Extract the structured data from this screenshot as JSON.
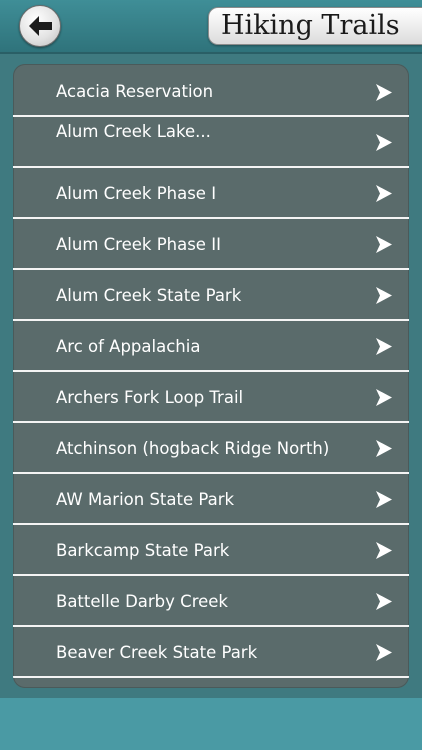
{
  "header": {
    "title": "Hiking Trails",
    "back_icon": "back-arrow-icon"
  },
  "trails": [
    {
      "label": "Acacia Reservation",
      "icon": "chevron-right-icon"
    },
    {
      "label": "Alum Creek Lake...",
      "icon": "chevron-right-icon"
    },
    {
      "label": "Alum Creek Phase I",
      "icon": "chevron-right-icon"
    },
    {
      "label": "Alum Creek Phase II",
      "icon": "chevron-right-icon"
    },
    {
      "label": "Alum Creek State Park",
      "icon": "chevron-right-icon"
    },
    {
      "label": "Arc of Appalachia",
      "icon": "chevron-right-icon"
    },
    {
      "label": "Archers Fork Loop Trail",
      "icon": "chevron-right-icon"
    },
    {
      "label": "Atchinson (hogback Ridge North)",
      "icon": "chevron-right-icon"
    },
    {
      "label": "AW Marion State Park",
      "icon": "chevron-right-icon"
    },
    {
      "label": "Barkcamp State Park",
      "icon": "chevron-right-icon"
    },
    {
      "label": "Battelle Darby Creek",
      "icon": "chevron-right-icon"
    },
    {
      "label": "Beaver Creek State Park",
      "icon": "chevron-right-icon"
    }
  ],
  "colors": {
    "background": "#3f7a80",
    "header": "#3f8e97",
    "list_panel": "#5a6b6b",
    "divider": "#f4f4f4",
    "bottom_bar": "#4a9aa4"
  }
}
